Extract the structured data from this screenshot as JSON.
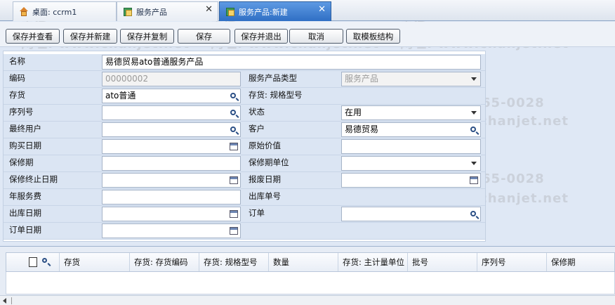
{
  "tabs": [
    {
      "label": "桌面: ccrm1",
      "icon": "home-icon"
    },
    {
      "label": "服务产品",
      "icon": "product-icon",
      "close": "✕"
    },
    {
      "label": "服务产品:新建",
      "icon": "product-new-icon",
      "close": "✕"
    }
  ],
  "toolbar": {
    "save_view": "保存并查看",
    "save_new": "保存并新建",
    "save_copy": "保存并复制",
    "save": "保存",
    "save_exit": "保存并退出",
    "cancel": "取消",
    "template": "取模板结构"
  },
  "form": {
    "name_label": "名称",
    "name_value": "易德贸易ato普通服务产品",
    "code_label": "编码",
    "code_value": "00000002",
    "type_label": "服务产品类型",
    "type_value": "服务产品",
    "stock_label": "存货",
    "stock_value": "ato普通",
    "spec_label": "存货: 规格型号",
    "spec_value": "",
    "serial_label": "序列号",
    "serial_value": "",
    "status_label": "状态",
    "status_value": "在用",
    "enduser_label": "最终用户",
    "enduser_value": "",
    "customer_label": "客户",
    "customer_value": "易德贸易",
    "buydate_label": "购买日期",
    "buydate_value": "",
    "origvalue_label": "原始价值",
    "origvalue_value": "",
    "warranty_label": "保修期",
    "warranty_value": "",
    "warrantyunit_label": "保修期单位",
    "warrantyunit_value": "",
    "warrantyend_label": "保修终止日期",
    "warrantyend_value": "",
    "scrapdate_label": "报废日期",
    "scrapdate_value": "",
    "annualfee_label": "年服务费",
    "annualfee_value": "",
    "outno_label": "出库单号",
    "outno_value": "",
    "outdate_label": "出库日期",
    "outdate_value": "",
    "order_label": "订单",
    "order_value": "",
    "orderdate_label": "订单日期",
    "orderdate_value": ""
  },
  "grid": {
    "columns": [
      "存货",
      "存货: 存货编码",
      "存货: 规格型号",
      "数量",
      "存货: 主计量单位",
      "批号",
      "序列号",
      "保修期"
    ]
  },
  "watermark": {
    "phone": "电话: 400-665-0028",
    "site": "网址: www.chanjet.net"
  }
}
